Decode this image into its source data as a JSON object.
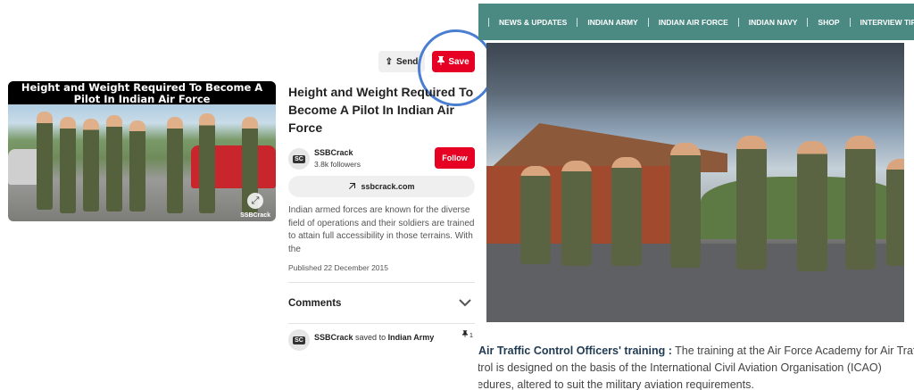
{
  "pin": {
    "image_caption": "Height and Weight Required To Become A Pilot In Indian Air Force",
    "watermark": "SSBCrack",
    "send_label": "Send",
    "save_label": "Save",
    "title": "Height and Weight Required To Become A Pilot In Indian Air Force",
    "author_avatar": "SC",
    "author_name": "SSBCrack",
    "followers": "3.8k followers",
    "follow_label": "Follow",
    "link_label": "ssbcrack.com",
    "description": "Indian armed forces are known for the diverse field of operations and their soldiers are trained to attain full accessibility in those terrains. With the",
    "published": "Published 22 December 2015",
    "comments_label": "Comments",
    "saved_by": "SSBCrack",
    "saved_to_text": "saved to",
    "saved_board": "Indian Army",
    "pin_count": "1"
  },
  "article": {
    "nav": [
      "NEWS & UPDATES",
      "INDIAN ARMY",
      "INDIAN AIR FORCE",
      "INDIAN NAVY",
      "SHOP",
      "INTERVIEW TIPS"
    ],
    "heading": "Air Traffic Control Officers' training :",
    "line1": "The training at the Air Force Academy for Air Traffic",
    "line2": "ntrol is designed on the basis of the International Civil Aviation Organisation (ICAO)",
    "line3": "cedures, altered to suit the military aviation requirements."
  },
  "colors": {
    "pinterest_red": "#e60023",
    "nav_teal": "#4a8a82",
    "highlight_blue": "#4a7ed0"
  }
}
